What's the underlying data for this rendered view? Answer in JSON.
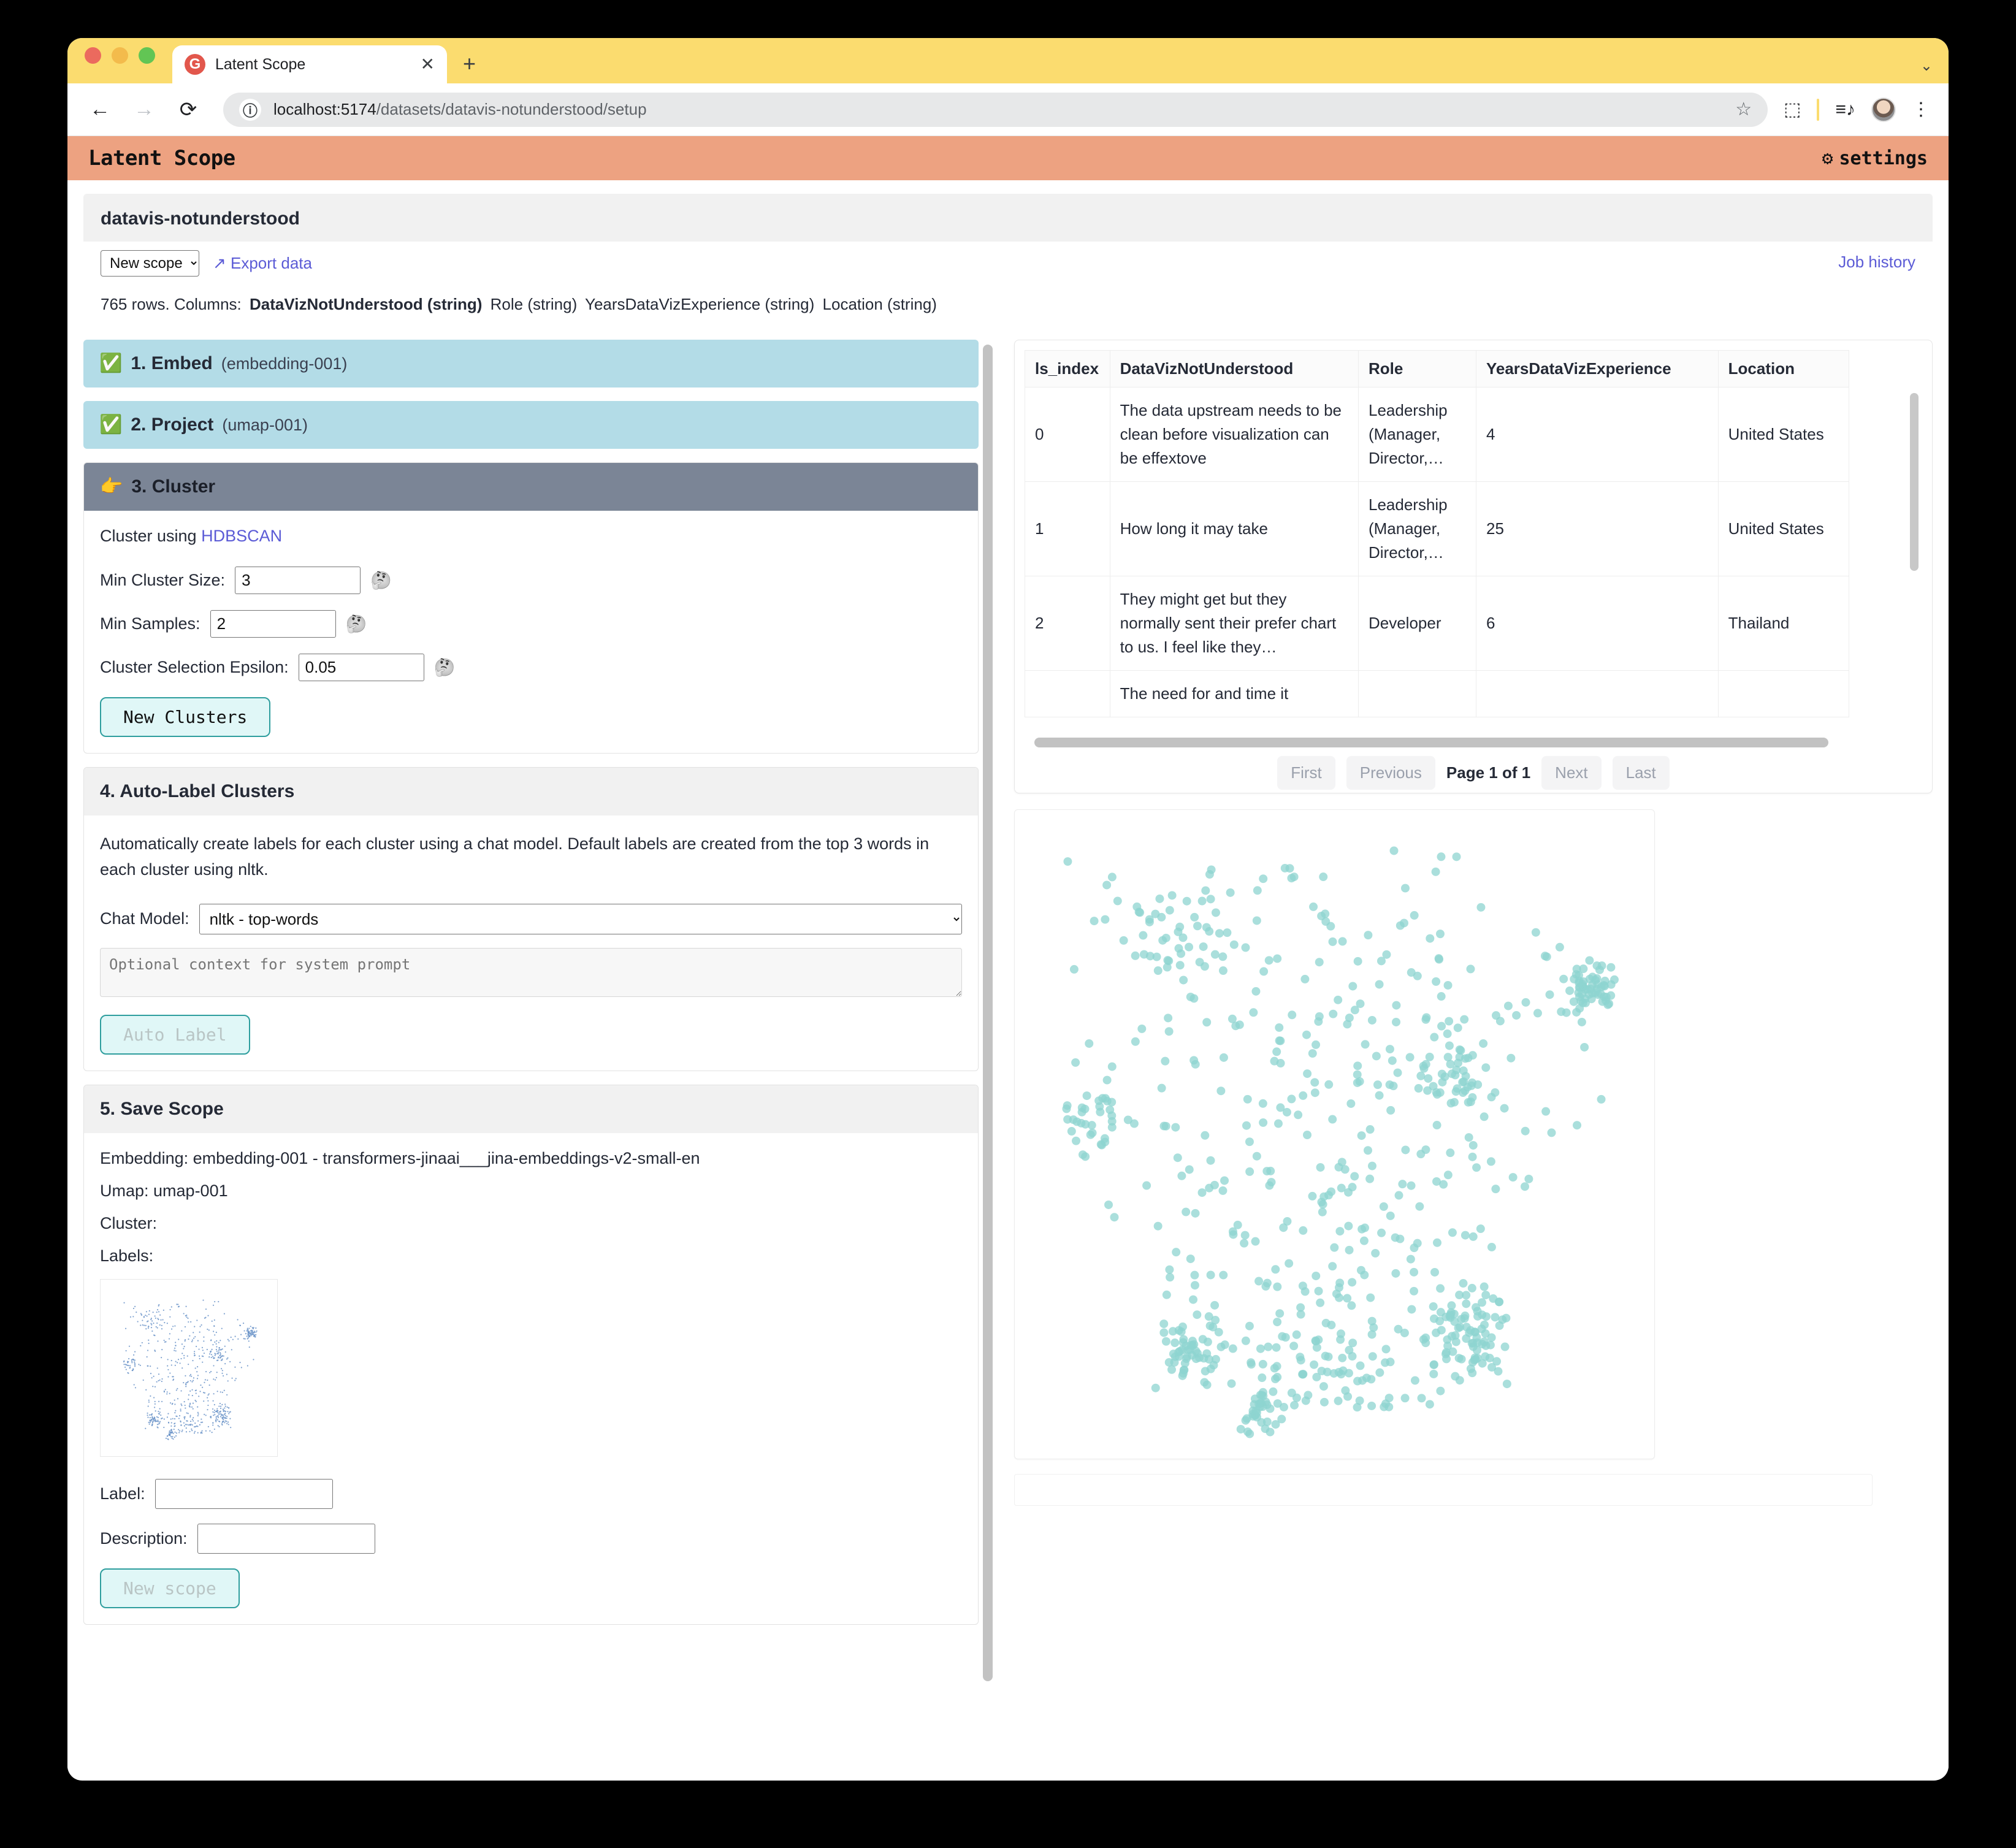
{
  "browser": {
    "tab_title": "Latent Scope",
    "favicon_glyph": "G",
    "close_glyph": "✕",
    "new_tab_glyph": "+",
    "tabstrip_overflow_glyph": "⌄",
    "back_glyph": "←",
    "forward_glyph": "→",
    "reload_glyph": "⟳",
    "site_info_glyph": "ⓘ",
    "url_host": "localhost:5174",
    "url_path": "/datasets/datavis-notunderstood/setup",
    "star_glyph": "☆",
    "extensions_glyph": "⬚",
    "media_glyph": "≡♪",
    "menu_glyph": "⋮"
  },
  "app": {
    "title": "Latent Scope",
    "settings_label": "settings",
    "settings_icon_glyph": "⚙",
    "header_color": "#eda281"
  },
  "dataset": {
    "name": "datavis-notunderstood",
    "scope_select_value": "New scope",
    "scope_select_options": [
      "New scope"
    ],
    "export_label": "↗ Export data",
    "job_history_label": "Job history",
    "rows_label": "765 rows. Columns:",
    "columns": [
      {
        "label": "DataVizNotUnderstood (string)",
        "bold": true
      },
      {
        "label": "Role (string)",
        "bold": false
      },
      {
        "label": "YearsDataVizExperience (string)",
        "bold": false
      },
      {
        "label": "Location (string)",
        "bold": false
      }
    ]
  },
  "steps": {
    "embed": {
      "icon": "✅",
      "title": "1. Embed",
      "sub": "(embedding-001)"
    },
    "project": {
      "icon": "✅",
      "title": "2. Project",
      "sub": "(umap-001)"
    },
    "cluster": {
      "icon": "👉",
      "title": "3. Cluster",
      "using_prefix": "Cluster using ",
      "algorithm": "HDBSCAN",
      "fields": [
        {
          "label": "Min Cluster Size:",
          "value": "3",
          "help": "🤔"
        },
        {
          "label": "Min Samples:",
          "value": "2",
          "help": "🤔"
        },
        {
          "label": "Cluster Selection Epsilon:",
          "value": "0.05",
          "help": "🤔"
        }
      ],
      "button_label": "New Clusters"
    },
    "autolabel": {
      "title": "4. Auto-Label Clusters",
      "description": "Automatically create labels for each cluster using a chat model. Default labels are created from the top 3 words in each cluster using nltk.",
      "chat_model_label": "Chat Model:",
      "chat_model_value": "nltk - top-words",
      "chat_model_options": [
        "nltk - top-words"
      ],
      "prompt_placeholder": "Optional context for system prompt",
      "prompt_value": "",
      "button_label": "Auto Label"
    },
    "savescope": {
      "title": "5. Save Scope",
      "embedding_line": "Embedding: embedding-001 - transformers-jinaai___jina-embeddings-v2-small-en",
      "umap_line": "Umap: umap-001",
      "cluster_line": "Cluster:",
      "labels_line": "Labels:",
      "label_field_label": "Label:",
      "label_field_value": "",
      "description_field_label": "Description:",
      "description_field_value": "",
      "button_label": "New scope"
    }
  },
  "table": {
    "headers": [
      "ls_index",
      "DataVizNotUnderstood",
      "Role",
      "YearsDataVizExperience",
      "Location"
    ],
    "rows": [
      {
        "ls_index": "0",
        "text": "The data upstream needs to be clean before visualization can be effextove",
        "role": "Leadership (Manager, Director,…",
        "years": "4",
        "location": "United States"
      },
      {
        "ls_index": "1",
        "text": "How long it may take",
        "role": "Leadership (Manager, Director,…",
        "years": "25",
        "location": "United States"
      },
      {
        "ls_index": "2",
        "text": "They might get but they normally sent their prefer chart to us. I feel like they…",
        "role": "Developer",
        "years": "6",
        "location": "Thailand"
      },
      {
        "ls_index": "",
        "text": "The need for and time it",
        "role": "",
        "years": "",
        "location": ""
      }
    ],
    "pagination": {
      "first": "First",
      "previous": "Previous",
      "page_indicator": "Page 1 of 1",
      "next": "Next",
      "last": "Last"
    }
  },
  "chart_data": {
    "type": "scatter",
    "title": "",
    "xlabel": "",
    "ylabel": "",
    "point_color": "#8ed4d0",
    "point_opacity": 0.75,
    "point_radius": 7,
    "n_points": 765,
    "xlim": [
      0,
      1
    ],
    "ylim": [
      0,
      1
    ],
    "grid": false,
    "legend": false,
    "description": "UMAP 2-D embedding projection of 765 survey responses; a single unclustered series rendered in light teal, forming a broad irregular blob with denser knots at upper-right, mid-right and lower-right, and a thin tail trailing to bottom-centre."
  },
  "thumbnail_chart": {
    "type": "scatter",
    "point_color": "#6a93c8",
    "n_points": 765,
    "description": "Miniature monochrome preview of the same UMAP projection shown in the Save Scope panel."
  }
}
